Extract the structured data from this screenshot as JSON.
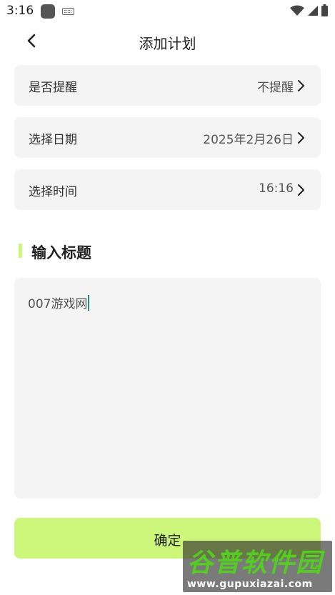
{
  "status_bar": {
    "time": "3:16",
    "icons": [
      "app-notification-icon",
      "keyboard-icon",
      "wifi-icon",
      "signal-icon",
      "battery-icon"
    ]
  },
  "header": {
    "title": "添加计划",
    "back_icon": "chevron-left-icon"
  },
  "rows": [
    {
      "label": "是否提醒",
      "value": "不提醒"
    },
    {
      "label": "选择日期",
      "value": "2025年2月26日"
    },
    {
      "label": "选择时间",
      "value": "16:16"
    }
  ],
  "section": {
    "title": "输入标题",
    "accent_color": "#cdf77a"
  },
  "title_input": {
    "value": "007游戏网"
  },
  "confirm_button": {
    "label": "确定",
    "color": "#cdf77a"
  },
  "watermark": {
    "logo_text": "谷普软件园",
    "url": "www.gupuxiazai.com"
  }
}
